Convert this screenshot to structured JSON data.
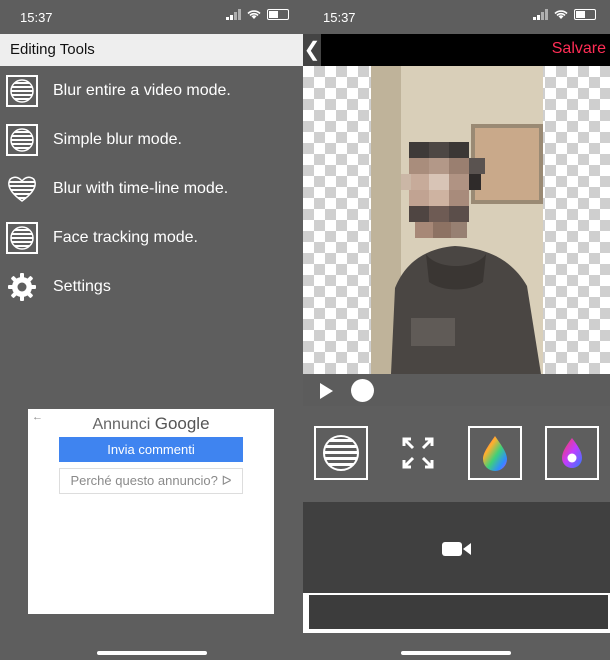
{
  "left": {
    "status": {
      "time": "15:37"
    },
    "header": {
      "title": "Editing Tools"
    },
    "menu": [
      {
        "label": "Blur entire a video mode.",
        "icon": "striped-circle-box-icon"
      },
      {
        "label": "Simple blur mode.",
        "icon": "striped-circle-box-icon"
      },
      {
        "label": "Blur with time-line mode.",
        "icon": "striped-heart-icon"
      },
      {
        "label": "Face tracking mode.",
        "icon": "striped-circle-box-icon"
      },
      {
        "label": "Settings",
        "icon": "gear-icon"
      }
    ],
    "ad": {
      "title_prefix": "Annunci",
      "title_brand": "Google",
      "feedback_button": "Invia commenti",
      "why_button": "Perché questo annuncio?",
      "back_glyph": "←",
      "why_glyph": "ᐅ"
    }
  },
  "right": {
    "status": {
      "time": "15:37"
    },
    "toolbar": {
      "back_glyph": "❮",
      "save_label": "Salvare"
    },
    "tools": [
      "striped-circle-icon",
      "expand-arrows-icon",
      "rainbow-drop-icon",
      "color-drop-icon"
    ]
  },
  "colors": {
    "accent_red": "#ff2d55",
    "ad_blue": "#3f84f0",
    "panel_gray": "#5e5e5e"
  }
}
